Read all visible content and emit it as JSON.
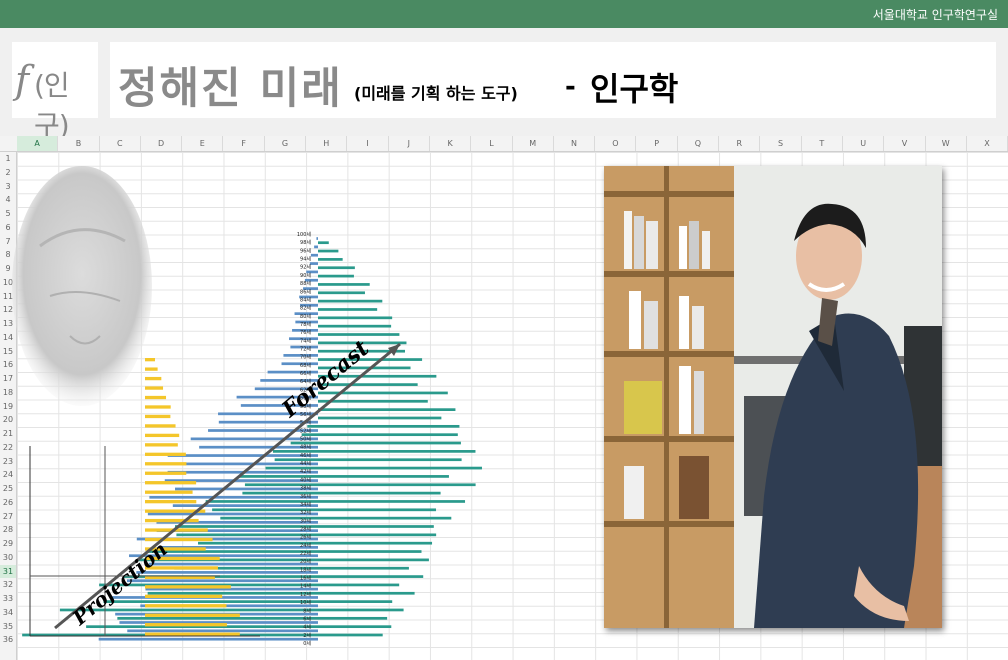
{
  "header": {
    "org": "서울대학교 인구학연구실"
  },
  "logo": {
    "f": "f",
    "text": "(인구)"
  },
  "title": {
    "main": "정해진 미래",
    "subtitle": "(미래를 기획 하는 도구)",
    "dash": "-",
    "end": "인구학"
  },
  "sheet": {
    "columns": [
      "A",
      "B",
      "C",
      "D",
      "E",
      "F",
      "G",
      "H",
      "I",
      "J",
      "K",
      "L",
      "M",
      "N",
      "O",
      "P",
      "Q",
      "R",
      "S",
      "T",
      "U",
      "V",
      "W",
      "X"
    ],
    "selected_column": "A",
    "rows": [
      "1",
      "2",
      "3",
      "4",
      "5",
      "6",
      "7",
      "8",
      "9",
      "10",
      "11",
      "12",
      "13",
      "14",
      "15",
      "16",
      "17",
      "18",
      "19",
      "20",
      "21",
      "22",
      "23",
      "24",
      "25",
      "26",
      "27",
      "28",
      "29",
      "30",
      "31",
      "32",
      "33",
      "34",
      "35",
      "36"
    ],
    "selected_row": "31"
  },
  "pyramid": {
    "age_labels": [
      "100세",
      "98세",
      "96세",
      "94세",
      "92세",
      "90세",
      "88세",
      "86세",
      "84세",
      "82세",
      "80세",
      "78세",
      "76세",
      "74세",
      "72세",
      "70세",
      "68세",
      "66세",
      "64세",
      "62세",
      "60세",
      "58세",
      "56세",
      "54세",
      "52세",
      "50세",
      "48세",
      "46세",
      "44세",
      "42세",
      "40세",
      "38세",
      "36세",
      "34세",
      "32세",
      "30세",
      "28세",
      "26세",
      "24세",
      "22세",
      "20세",
      "18세",
      "16세",
      "14세",
      "12세",
      "10세",
      "8세",
      "6세",
      "4세",
      "2세",
      "0세"
    ],
    "forecast_label": "Forecast",
    "projection_label": "Projection"
  },
  "colors": {
    "topbar": "#4a8a62",
    "teal": "#2a9a8c",
    "blue": "#5b8fc6",
    "yellow": "#f4c62a"
  }
}
